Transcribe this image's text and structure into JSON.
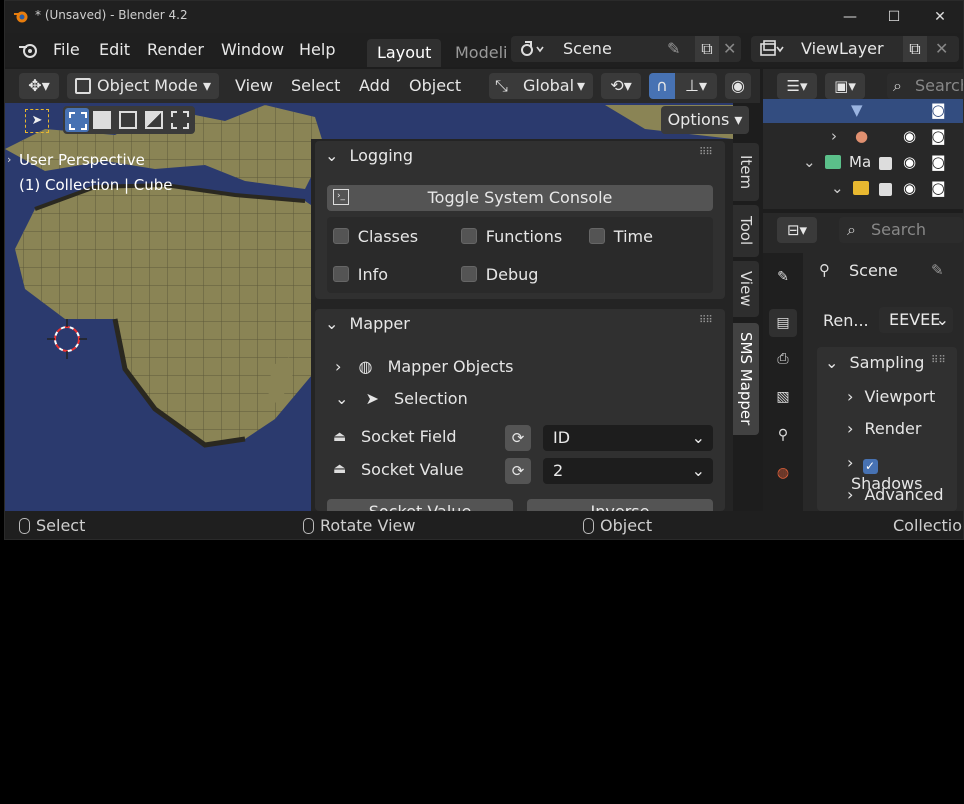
{
  "window": {
    "title": "* (Unsaved) - Blender 4.2",
    "minimize": "—",
    "maximize": "☐",
    "close": "✕"
  },
  "menubar": {
    "items": [
      "File",
      "Edit",
      "Render",
      "Window",
      "Help"
    ],
    "workspace_tabs": [
      "Layout",
      "Modeli"
    ],
    "scene": "Scene",
    "viewlayer": "ViewLayer"
  },
  "viewport_header": {
    "mode": "Object Mode",
    "menus": [
      "View",
      "Select",
      "Add",
      "Object"
    ],
    "transform_orientation": "Global",
    "options": "Options"
  },
  "viewport": {
    "perspective": "User Perspective",
    "collection": "(1) Collection | Cube"
  },
  "sidebar_tabs": [
    "Item",
    "Tool",
    "View",
    "SMS Mapper"
  ],
  "logging_panel": {
    "title": "Logging",
    "console_button": "Toggle System Console",
    "checkboxes": [
      {
        "label": "Classes",
        "checked": false
      },
      {
        "label": "Functions",
        "checked": false
      },
      {
        "label": "Time",
        "checked": false
      },
      {
        "label": "Info",
        "checked": false
      },
      {
        "label": "Debug",
        "checked": false
      }
    ]
  },
  "mapper_panel": {
    "title": "Mapper",
    "subpanels": [
      "Mapper Objects",
      "Selection"
    ],
    "socket_field_label": "Socket Field",
    "socket_field_value": "ID",
    "socket_value_label": "Socket Value",
    "socket_value_value": "2",
    "bottom_buttons": [
      "Socket Value",
      "Inverse"
    ]
  },
  "outliner": {
    "search_placeholder": "Search",
    "rows": [
      {
        "label": "",
        "icon": "mesh-icon"
      },
      {
        "label": "",
        "icon": "light-icon"
      },
      {
        "label": "Ma",
        "icon": "collection-icon"
      },
      {
        "label": "",
        "icon": "collection-icon-yellow"
      }
    ]
  },
  "properties": {
    "search_placeholder": "Search",
    "scene_label": "Scene",
    "render_engine_label": "Ren...",
    "render_engine": "EEVEE",
    "sampling": "Sampling",
    "items": [
      {
        "label": "Viewport",
        "checkbox": false
      },
      {
        "label": "Render",
        "checkbox": false
      },
      {
        "label": "Shadows",
        "checkbox": true
      },
      {
        "label": "Advanced",
        "checkbox": false
      }
    ]
  },
  "statusbar": {
    "select": "Select",
    "rotate": "Rotate View",
    "object": "Object",
    "collection": "Collection"
  },
  "colors": {
    "accent": "#4772b3",
    "viewport_bg": "#2b3a6e",
    "land": "#8a8455"
  }
}
